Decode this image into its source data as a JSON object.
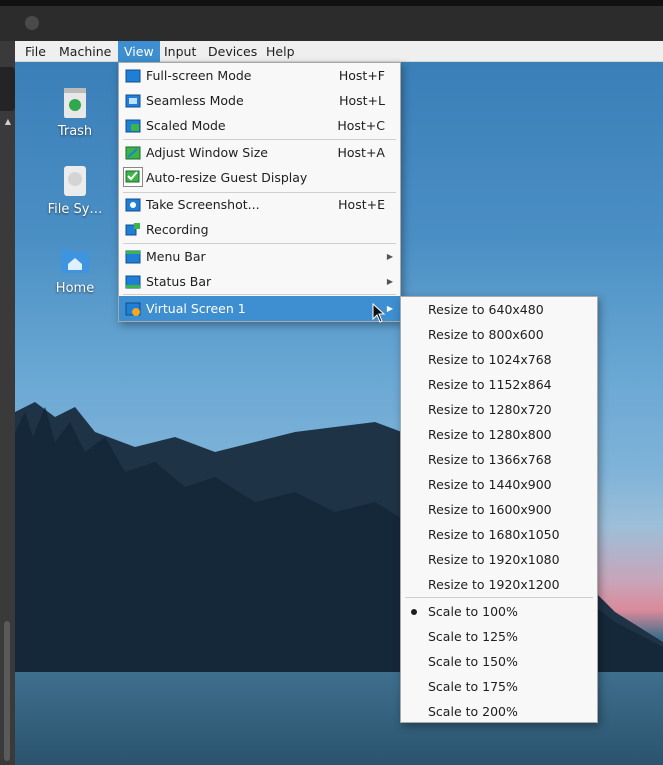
{
  "menubar": {
    "items": [
      "File",
      "Machine",
      "View",
      "Input",
      "Devices",
      "Help"
    ],
    "active": "View"
  },
  "desktop": {
    "icons": [
      {
        "label": "Trash",
        "icon": "trash-icon"
      },
      {
        "label": "File Sy…",
        "icon": "drive-icon"
      },
      {
        "label": "Home",
        "icon": "home-folder-icon"
      }
    ]
  },
  "view_menu": {
    "items": [
      {
        "label": "Full-screen Mode",
        "shortcut": "Host+F",
        "icon": "fullscreen-icon"
      },
      {
        "label": "Seamless Mode",
        "shortcut": "Host+L",
        "icon": "seamless-icon"
      },
      {
        "label": "Scaled Mode",
        "shortcut": "Host+C",
        "icon": "scaled-icon"
      },
      {
        "label": "Adjust Window Size",
        "shortcut": "Host+A",
        "icon": "adjust-window-icon"
      },
      {
        "label": "Auto-resize Guest Display",
        "shortcut": "",
        "icon": "auto-resize-checkbox-icon"
      },
      {
        "label": "Take Screenshot...",
        "shortcut": "Host+E",
        "icon": "screenshot-icon"
      },
      {
        "label": "Recording",
        "shortcut": "",
        "icon": "recording-icon"
      },
      {
        "label": "Menu Bar",
        "shortcut": "",
        "icon": "menu-bar-icon"
      },
      {
        "label": "Status Bar",
        "shortcut": "",
        "icon": "status-bar-icon"
      },
      {
        "label": "Virtual Screen 1",
        "shortcut": "",
        "icon": "virtual-screen-icon"
      }
    ]
  },
  "virtual_screen_submenu": {
    "resize": [
      "Resize to 640x480",
      "Resize to 800x600",
      "Resize to 1024x768",
      "Resize to 1152x864",
      "Resize to 1280x720",
      "Resize to 1280x800",
      "Resize to 1366x768",
      "Resize to 1440x900",
      "Resize to 1600x900",
      "Resize to 1680x1050",
      "Resize to 1920x1080",
      "Resize to 1920x1200"
    ],
    "scale": [
      "Scale to 100%",
      "Scale to 125%",
      "Scale to 150%",
      "Scale to 175%",
      "Scale to 200%"
    ],
    "selected_scale": "Scale to 100%"
  },
  "colors": {
    "highlight": "#3d8fd1",
    "menu_bg": "#f8f8f8"
  }
}
